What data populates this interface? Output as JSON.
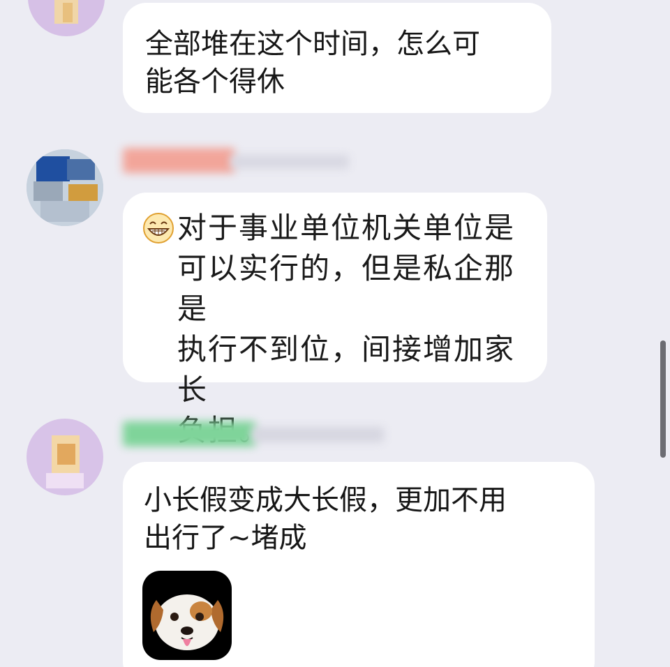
{
  "messages": [
    {
      "text": "全部堆在这个时间，怎么可\n能各个得休"
    },
    {
      "emoji": "grinning-face-emoji",
      "text": "对于事业单位机关单位是\n可以实行的，但是私企那是\n执行不到位，间接增加家长\n负担。"
    },
    {
      "text": "小长假变成大长假，更加不用\n出行了~堵成",
      "sticker": "dog-face-emoji"
    }
  ],
  "colors": {
    "background": "#ececf3",
    "bubble": "#ffffff",
    "name_blur_red": "#f2a59a",
    "name_blur_green": "#7fd49a",
    "scrollbar": "#6c6c72"
  }
}
